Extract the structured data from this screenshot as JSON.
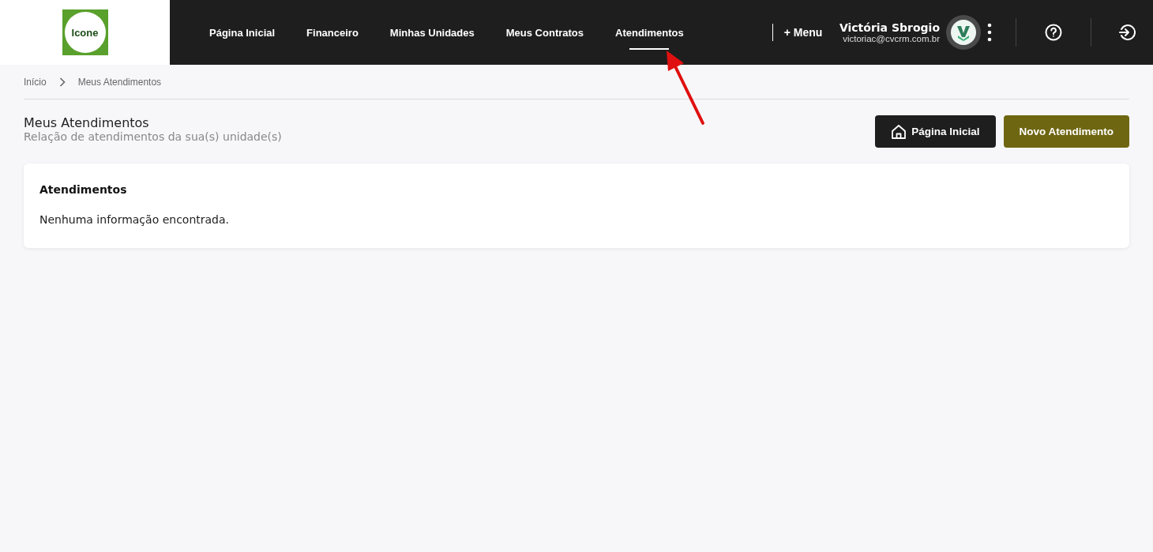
{
  "logo": {
    "text": "Icone"
  },
  "nav": [
    {
      "label": "Página Inicial",
      "selected": false
    },
    {
      "label": "Financeiro",
      "selected": false
    },
    {
      "label": "Minhas Unidades",
      "selected": false
    },
    {
      "label": "Meus Contratos",
      "selected": false
    },
    {
      "label": "Atendimentos",
      "selected": true
    }
  ],
  "more_menu": "+ Menu",
  "user": {
    "name": "Victória Sbrogio",
    "email": "victoriac@cvcrm.com.br"
  },
  "breadcrumb": [
    "Início",
    "Meus Atendimentos"
  ],
  "page": {
    "title": "Meus Atendimentos",
    "subtitle": "Relação de atendimentos da sua(s) unidade(s)"
  },
  "buttons": [
    {
      "kind": "home",
      "label": "Página Inicial"
    },
    {
      "kind": "primary",
      "label": "Novo Atendimento"
    }
  ],
  "card": {
    "title": "Atendimentos",
    "message": "Nenhuma informação encontrada."
  }
}
